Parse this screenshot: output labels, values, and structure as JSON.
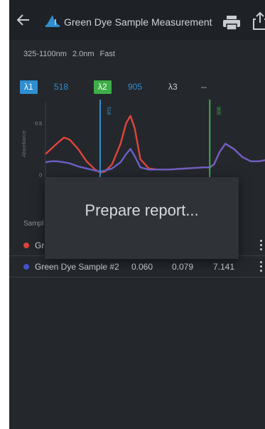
{
  "header": {
    "title": "Green Dye Sample Measurement",
    "back_icon": "arrow-left-icon",
    "app_icon": "spectrometer-icon",
    "print_icon": "printer-icon",
    "share_icon": "share-icon"
  },
  "params": {
    "range": "325-1100nm",
    "interval": "2.0nm",
    "speed": "Fast"
  },
  "wavelengths": {
    "l1_label": "λ1",
    "l1_value": "518",
    "l2_label": "λ2",
    "l2_value": "905",
    "l3_label": "λ3",
    "l3_value": "--"
  },
  "chart_data": {
    "type": "line",
    "ylabel": "Absorbance",
    "yticks": [
      "0.5",
      "0"
    ],
    "ylim": [
      -0.1,
      0.7
    ],
    "xlim": [
      325,
      1100
    ],
    "markers": [
      {
        "label": "518",
        "x": 518,
        "color": "#2f8fd0"
      },
      {
        "label": "905",
        "x": 905,
        "color": "#3fae49"
      }
    ],
    "series": [
      {
        "color": "#e0453a",
        "x": [
          325,
          345,
          365,
          390,
          410,
          440,
          470,
          500,
          518,
          535,
          560,
          590,
          610,
          625,
          640,
          660,
          690,
          720,
          760,
          820,
          880,
          905,
          920,
          940,
          960,
          990,
          1020,
          1050,
          1080,
          1100
        ],
        "y": [
          0.2,
          0.25,
          0.3,
          0.36,
          0.34,
          0.25,
          0.13,
          0.05,
          0.02,
          0.03,
          0.1,
          0.3,
          0.5,
          0.57,
          0.45,
          0.15,
          0.06,
          0.05,
          0.05,
          0.06,
          0.07,
          0.07,
          0.1,
          0.22,
          0.3,
          0.25,
          0.17,
          0.13,
          0.13,
          0.14
        ]
      },
      {
        "color": "#6b5fc4",
        "x": [
          325,
          345,
          365,
          390,
          410,
          440,
          470,
          500,
          518,
          535,
          560,
          590,
          610,
          625,
          640,
          660,
          690,
          720,
          760,
          820,
          880,
          905,
          920,
          940,
          960,
          990,
          1020,
          1050,
          1080,
          1100
        ],
        "y": [
          0.12,
          0.13,
          0.13,
          0.12,
          0.11,
          0.08,
          0.06,
          0.04,
          0.03,
          0.04,
          0.06,
          0.12,
          0.2,
          0.25,
          0.18,
          0.07,
          0.05,
          0.05,
          0.05,
          0.06,
          0.07,
          0.07,
          0.1,
          0.22,
          0.3,
          0.25,
          0.17,
          0.13,
          0.13,
          0.14
        ]
      }
    ]
  },
  "list": {
    "header": "Sampl",
    "rows": [
      {
        "name": "Gr",
        "v1": "",
        "v2": "",
        "v3": "l",
        "color": "#d8433a"
      },
      {
        "name": "Green Dye Sample #2",
        "v1": "0.060",
        "v2": "0.079",
        "v3": "7.141",
        "color": "#4650c8"
      }
    ]
  },
  "dialog": {
    "message": "Prepare report..."
  },
  "colors": {
    "lambda1": "#2f8fd0",
    "lambda2": "#3fae49",
    "background": "#24272c",
    "pager_active": "#2f8fd0"
  }
}
